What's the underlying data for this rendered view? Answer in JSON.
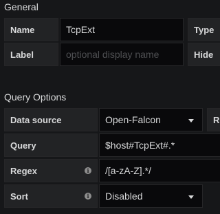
{
  "general": {
    "title": "General",
    "name_label": "Name",
    "name_value": "TcpExt",
    "type_label": "Type",
    "label_label": "Label",
    "label_placeholder": "optional display name",
    "hide_label": "Hide"
  },
  "query_options": {
    "title": "Query Options",
    "datasource_label": "Data source",
    "datasource_value": "Open-Falcon",
    "refresh_label_partial": "Re",
    "query_label": "Query",
    "query_value": "$host#TcpExt#.*",
    "regex_label": "Regex",
    "regex_value": "/[a-zA-Z].*/",
    "sort_label": "Sort",
    "sort_value": "Disabled"
  },
  "icons": {
    "info": "i"
  },
  "colors": {
    "background": "#161719",
    "label_bg": "#222325",
    "input_bg": "#09090b",
    "text": "#d8d9da",
    "placeholder": "#4e4f52"
  }
}
